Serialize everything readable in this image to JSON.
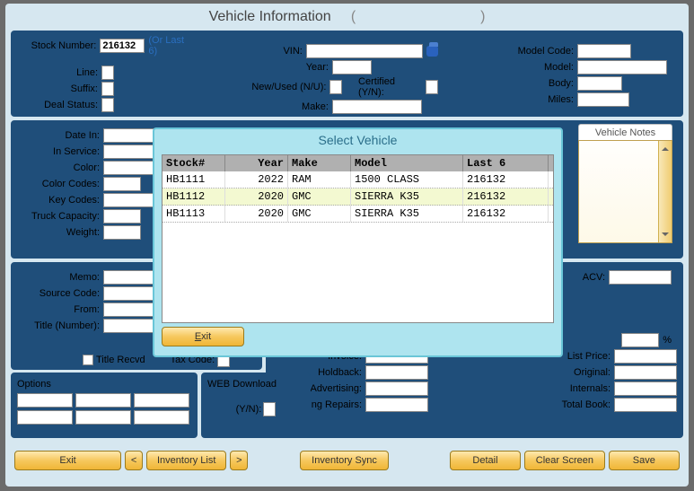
{
  "title": "Vehicle Information",
  "title_paren_open": "(",
  "title_paren_close": ")",
  "or_last6": "(Or Last 6)",
  "stock_number_label": "Stock Number:",
  "stock_number_value": "216132",
  "line_label": "Line:",
  "suffix_label": "Suffix:",
  "deal_status_label": "Deal Status:",
  "vin_label": "VIN:",
  "year_label": "Year:",
  "new_used_label": "New/Used (N/U):",
  "certified_label": "Certified (Y/N):",
  "make_label": "Make:",
  "model_code_label": "Model Code:",
  "model_label": "Model:",
  "body_label": "Body:",
  "miles_label": "Miles:",
  "date_in_label": "Date In:",
  "in_service_label": "In Service:",
  "color_label": "Color:",
  "color_codes_label": "Color Codes:",
  "key_codes_label": "Key Codes:",
  "truck_capacity_label": "Truck Capacity:",
  "weight_label": "Weight:",
  "vehicle_notes_tab": "Vehicle Notes",
  "memo_label": "Memo:",
  "source_code_label": "Source Code:",
  "from_label": "From:",
  "title_number_label": "Title (Number):",
  "title_recvd_label": "Title Recvd",
  "tax_code_label": "Tax Code:",
  "acv_label": "ACV:",
  "percent_label": "%",
  "invoice_label": "Invoice:",
  "holdback_label": "Holdback:",
  "advertising_label": "Advertising:",
  "pending_repairs_label": "Pending Repairs:",
  "list_price_label": "List Price:",
  "original_label": "Original:",
  "internals_label": "Internals:",
  "total_book_label": "Total Book:",
  "options_title": "Options",
  "web_download_title": "WEB Download",
  "web_yn_label": "(Y/N):",
  "buttons": {
    "exit": "Exit",
    "prev": "<",
    "inv_list": "Inventory List",
    "next": ">",
    "inv_sync": "Inventory Sync",
    "detail": "Detail",
    "clear": "Clear Screen",
    "save": "Save"
  },
  "modal": {
    "title": "Select Vehicle",
    "headers": [
      "Stock#",
      "Year",
      "Make",
      "Model",
      "Last 6"
    ],
    "rows": [
      {
        "stock": "HB1111",
        "year": "2022",
        "make": "RAM",
        "model": "1500 CLASS",
        "last6": "216132",
        "sel": false
      },
      {
        "stock": "HB1112",
        "year": "2020",
        "make": "GMC",
        "model": "SIERRA K35",
        "last6": "216132",
        "sel": true
      },
      {
        "stock": "HB1113",
        "year": "2020",
        "make": "GMC",
        "model": "SIERRA K35",
        "last6": "216132",
        "sel": false
      }
    ],
    "exit_btn": "Exit"
  }
}
